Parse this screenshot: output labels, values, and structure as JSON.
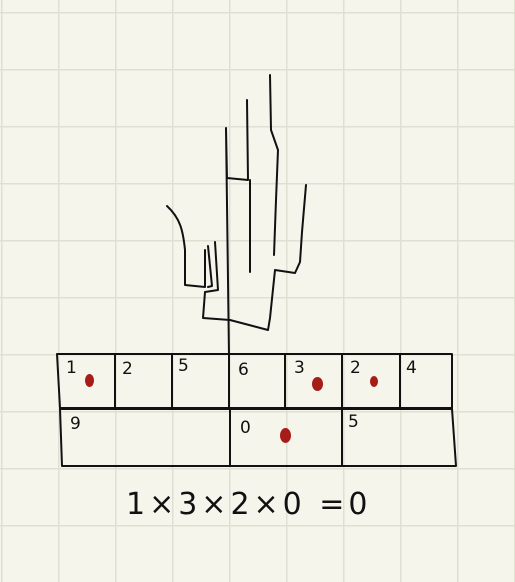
{
  "top_row": [
    "1",
    "2",
    "5",
    "6",
    "3",
    "2",
    "4"
  ],
  "bottom_row": [
    "9",
    "0",
    "5"
  ],
  "marked_digits": [
    "1",
    "3",
    "2",
    "0"
  ],
  "equation": "1×3×2×0 =0",
  "colors": {
    "ink": "#111111",
    "marker": "#a51d16",
    "paper": "#f6f5ec",
    "grid": "#dfe0d2"
  }
}
